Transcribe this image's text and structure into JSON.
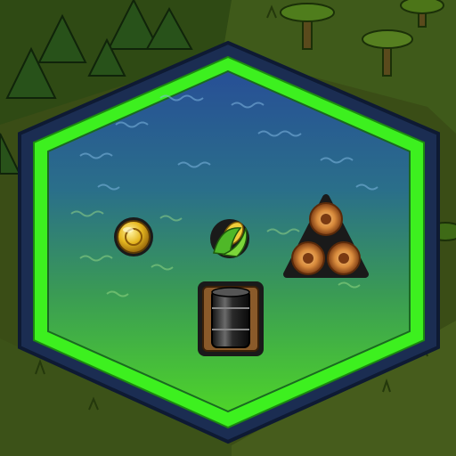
{
  "tile": {
    "terrain": "water",
    "selected": true,
    "colors": {
      "outer_border": "#1b2d52",
      "selection_glow": "#3df01f",
      "water_top": "#2a5aa3",
      "water_bottom": "#4fcf2a",
      "grass": "#3e5418",
      "forest_dark": "#22400f"
    },
    "resources": [
      {
        "name": "gold-coin-icon",
        "type": "gold"
      },
      {
        "name": "corn-icon",
        "type": "food"
      },
      {
        "name": "lumber-logs-icon",
        "type": "wood"
      },
      {
        "name": "oil-barrel-icon",
        "type": "oil"
      }
    ]
  }
}
